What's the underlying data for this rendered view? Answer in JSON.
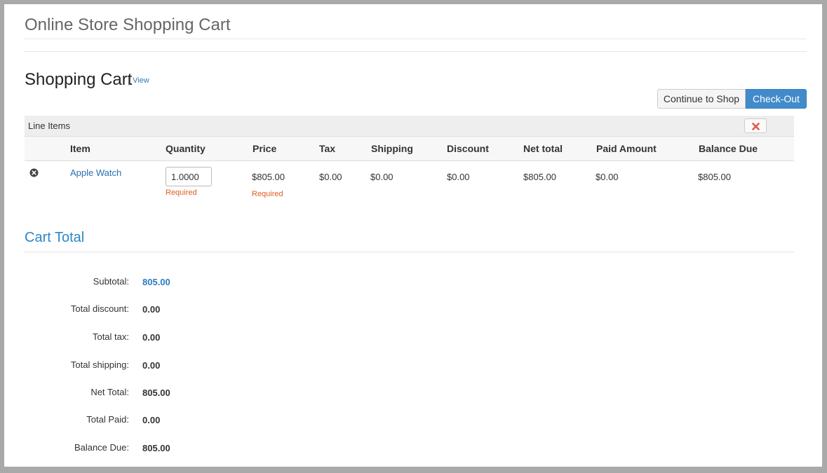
{
  "app": {
    "title": "Online Store Shopping Cart"
  },
  "cart": {
    "heading": "Shopping Cart",
    "separator": "|",
    "view_link": "View",
    "buttons": {
      "continue": "Continue to Shop",
      "checkout": "Check-Out"
    },
    "line_items_label": "Line Items",
    "columns": [
      "Item",
      "Quantity",
      "Price",
      "Tax",
      "Shipping",
      "Discount",
      "Net total",
      "Paid Amount",
      "Balance Due"
    ],
    "rows": [
      {
        "item": "Apple Watch",
        "quantity": "1.0000",
        "quantity_hint": "Required",
        "price": "$805.00",
        "price_hint": "Required",
        "tax": "$0.00",
        "shipping": "$0.00",
        "discount": "$0.00",
        "net_total": "$805.00",
        "paid_amount": "$0.00",
        "balance_due": "$805.00"
      }
    ]
  },
  "totals": {
    "title": "Cart Total",
    "subtotal_label": "Subtotal:",
    "subtotal": "805.00",
    "discount_label": "Total discount:",
    "discount": "0.00",
    "tax_label": "Total tax:",
    "tax": "0.00",
    "shipping_label": "Total shipping:",
    "shipping": "0.00",
    "net_label": "Net Total:",
    "net": "805.00",
    "paid_label": "Total Paid:",
    "paid": "0.00",
    "balance_label": "Balance Due:",
    "balance": "805.00"
  },
  "colors": {
    "accent": "#2a88c8",
    "primary_button": "#428bca",
    "required": "#e05a1f",
    "clear_icon": "#e05a4a"
  },
  "icons": {
    "remove": "remove-circle-icon",
    "clear": "close-icon"
  }
}
